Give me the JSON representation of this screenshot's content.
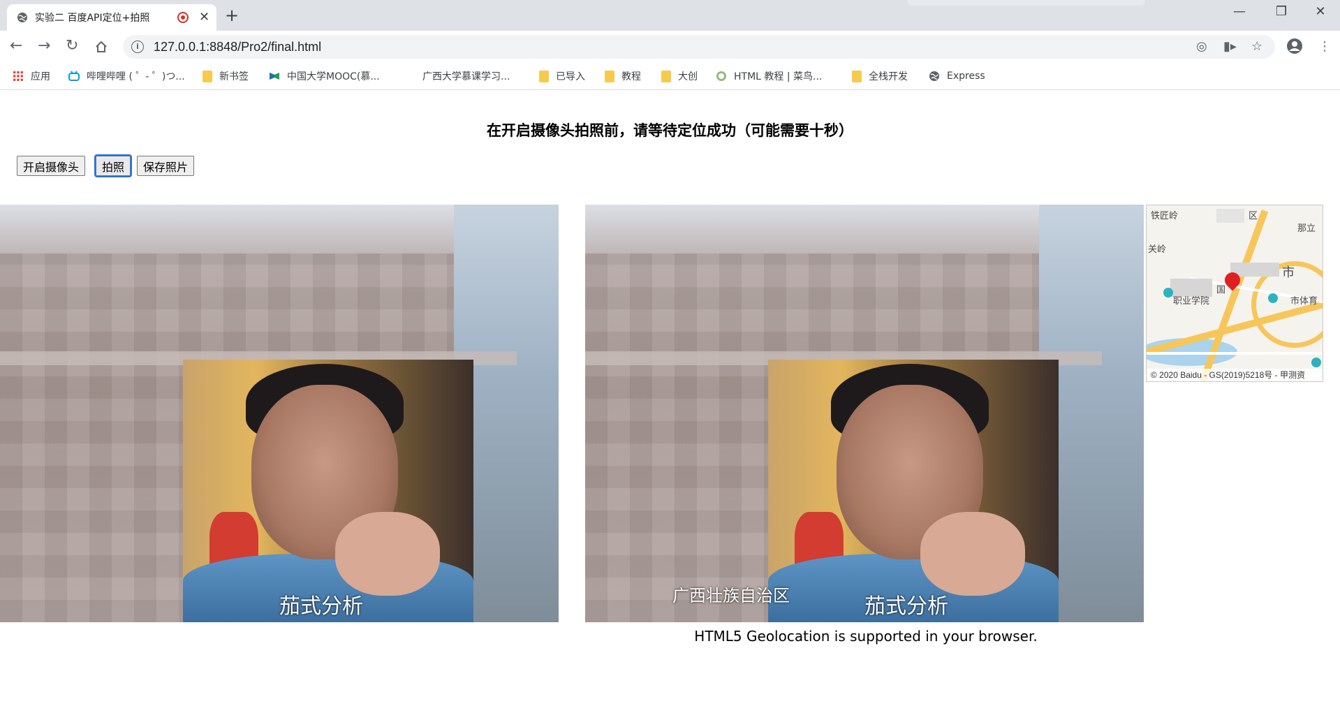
{
  "browser": {
    "tab_title": "实验二 百度API定位+拍照",
    "tab_close": "✕",
    "new_tab": "+",
    "window_controls": [
      "—",
      "❐",
      "✕"
    ],
    "url": "127.0.0.1:8848/Pro2/final.html",
    "nav_icons": [
      "back-arrow-icon",
      "forward-arrow-icon",
      "reload-icon",
      "home-icon"
    ]
  },
  "bookmarks": [
    {
      "label": "应用",
      "icon": "apps-grid-icon"
    },
    {
      "label": "哔哩哔哩 ( ゜- ゜)つ...",
      "icon": "bilibili-icon"
    },
    {
      "label": "新书签",
      "icon": "folder-icon"
    },
    {
      "label": "中国大学MOOC(慕...",
      "icon": "mooc-icon"
    },
    {
      "label": "广西大学慕课学习...",
      "icon": "none"
    },
    {
      "label": "已导入",
      "icon": "folder-icon"
    },
    {
      "label": "教程",
      "icon": "folder-icon"
    },
    {
      "label": "大创",
      "icon": "folder-icon"
    },
    {
      "label": "HTML 教程 | 菜鸟...",
      "icon": "runoob-icon"
    },
    {
      "label": "全栈开发",
      "icon": "folder-icon"
    },
    {
      "label": "Express",
      "icon": "globe-icon"
    }
  ],
  "page": {
    "heading": "在开启摄像头拍照前，请等待定位成功（可能需要十秒）",
    "buttons": {
      "open_camera": "开启摄像头",
      "take_photo": "拍照",
      "save_photo": "保存照片"
    },
    "video_caption": "茄式分析",
    "photo_caption": "茄式分析",
    "photo_location": "广西壮族自治区",
    "status": "HTML5 Geolocation is supported in your browser."
  },
  "map": {
    "labels": [
      "铁匠岭",
      "区",
      "那立",
      "关岭",
      "市",
      "国",
      "职业学院",
      "市体育"
    ],
    "copyright": "© 2020 Baidu - GS(2019)5218号 - 甲测资"
  }
}
